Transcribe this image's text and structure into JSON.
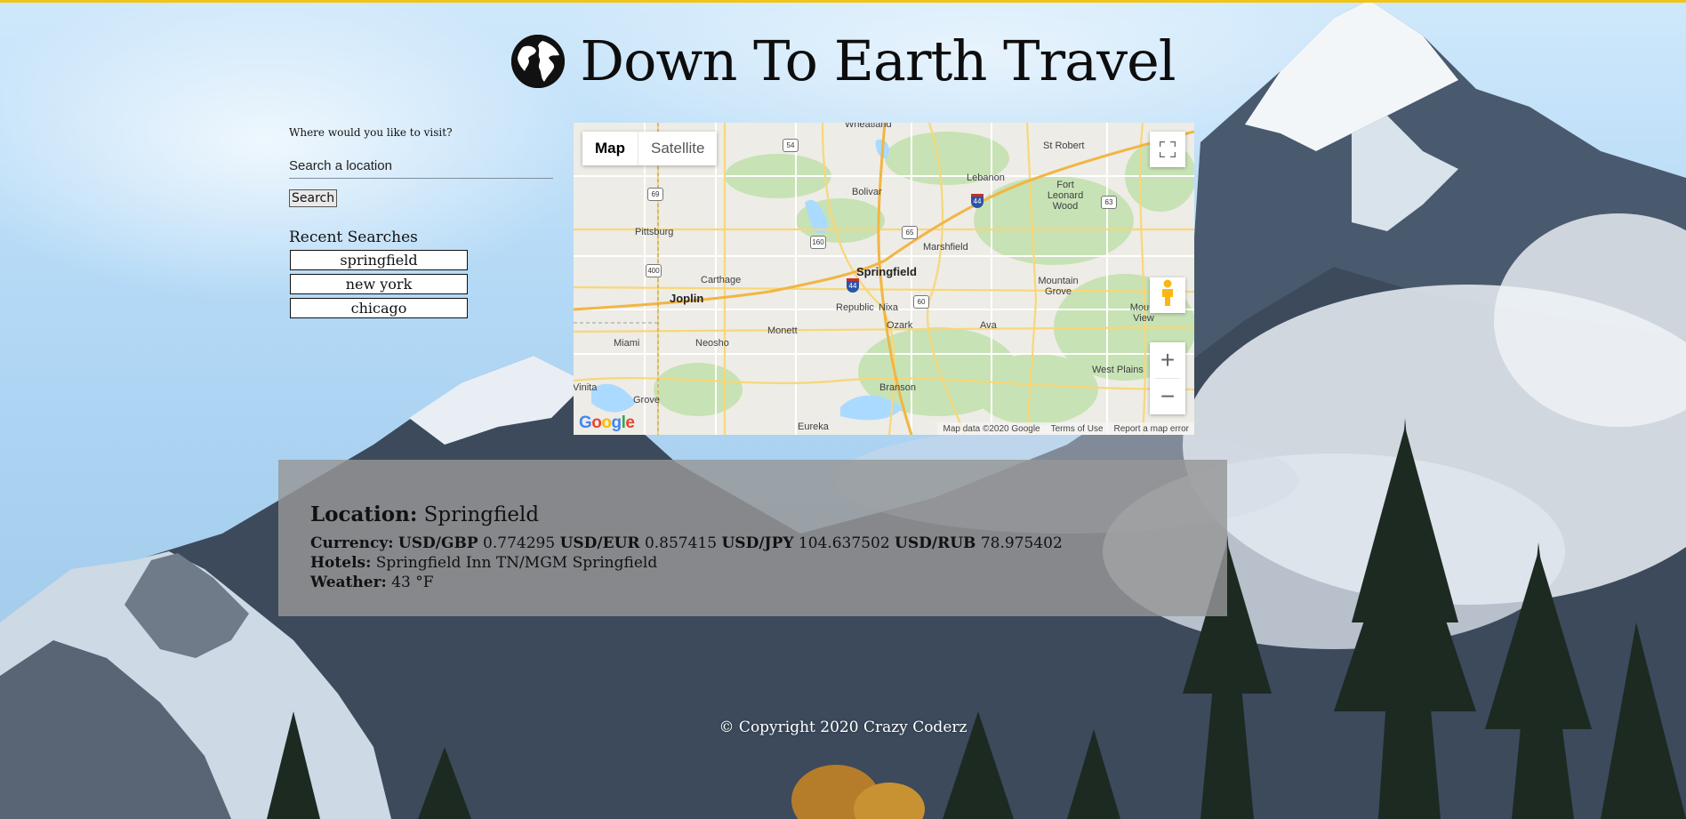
{
  "header": {
    "title": "Down To Earth Travel",
    "icon": "globe-icon"
  },
  "search": {
    "prompt": "Where would you like to visit?",
    "placeholder": "Search a location",
    "button_label": "Search"
  },
  "recent": {
    "title": "Recent Searches",
    "items": [
      "springfield",
      "new york",
      "chicago"
    ]
  },
  "map": {
    "type_buttons": [
      "Map",
      "Satellite"
    ],
    "active_type": "Map",
    "places": [
      "Wheatland",
      "St Robert",
      "Lebanon",
      "Fort Leonard Wood",
      "Bolivar",
      "Pittsburg",
      "Marshfield",
      "Springfield",
      "Carthage",
      "Joplin",
      "Mountain Grove",
      "Republic",
      "Nixa",
      "Ozark",
      "Ava",
      "Mount View",
      "Monett",
      "Neosho",
      "Miami",
      "West Plains",
      "Vinita",
      "Grove",
      "Branson",
      "Eureka"
    ],
    "route_shields": [
      "54",
      "69",
      "160",
      "400",
      "65",
      "60",
      "63",
      "44"
    ],
    "attribution": [
      "Map data ©2020 Google",
      "Terms of Use",
      "Report a map error"
    ],
    "logo": "Google"
  },
  "info": {
    "location_label": "Location:",
    "location_value": "Springfield",
    "currency_label": "Currency:",
    "currency_pairs": [
      {
        "pair": "USD/GBP",
        "rate": "0.774295"
      },
      {
        "pair": "USD/EUR",
        "rate": "0.857415"
      },
      {
        "pair": "USD/JPY",
        "rate": "104.637502"
      },
      {
        "pair": "USD/RUB",
        "rate": "78.975402"
      }
    ],
    "hotels_label": "Hotels:",
    "hotels_value": "Springfield Inn TN/MGM Springfield",
    "weather_label": "Weather:",
    "weather_value": "43 °F"
  },
  "footer": {
    "copyright": "© Copyright 2020 Crazy Coderz"
  },
  "colors": {
    "top_border": "#f0c419",
    "info_bg": "#969696"
  }
}
